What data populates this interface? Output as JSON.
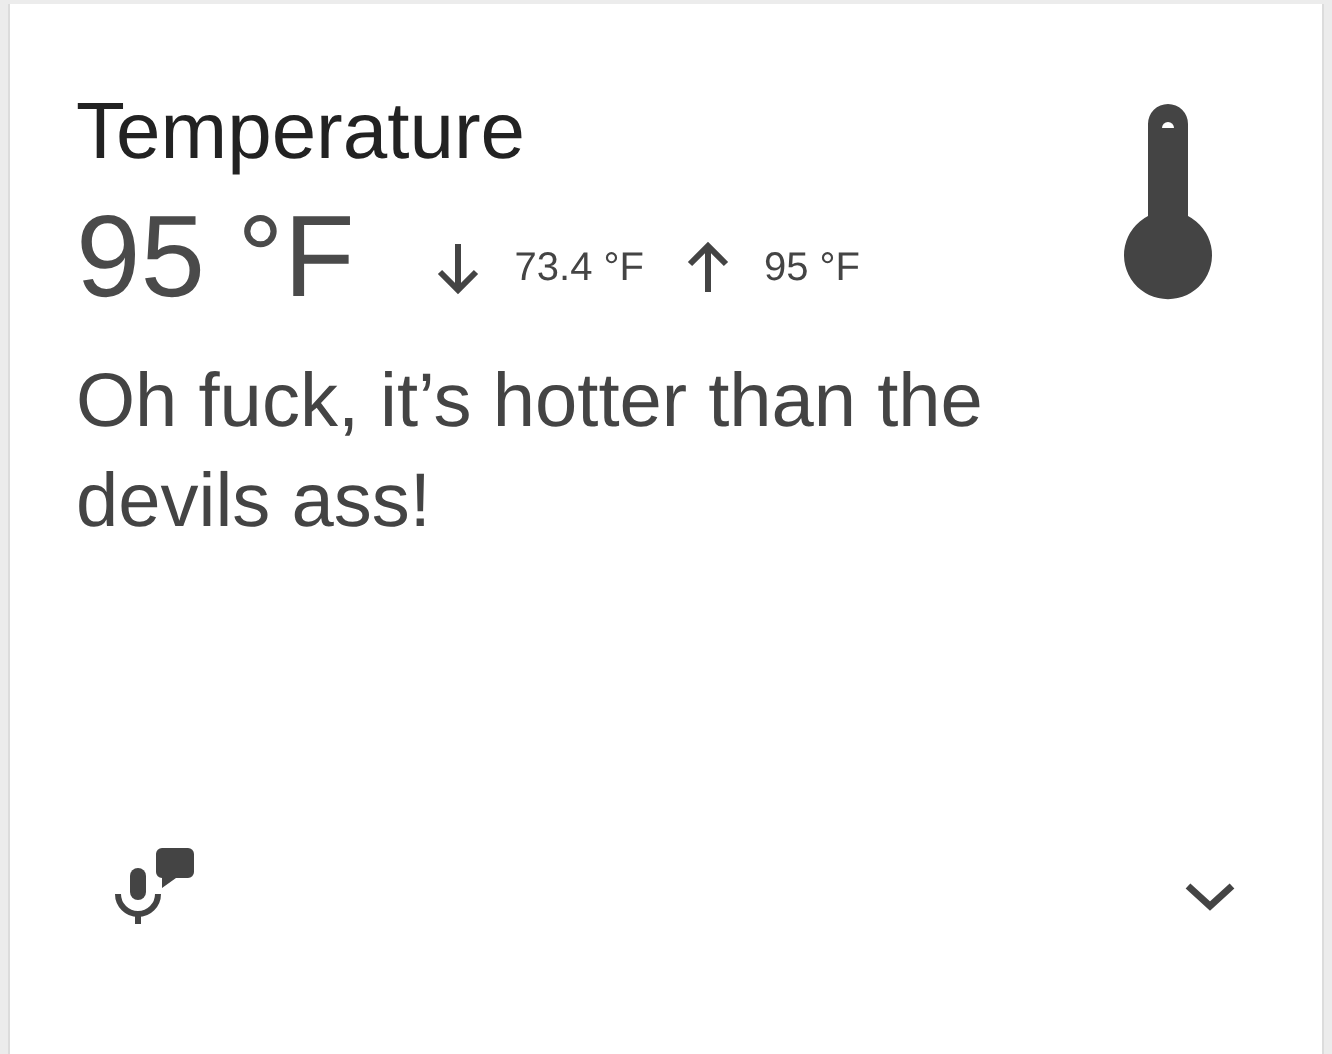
{
  "card": {
    "title": "Temperature",
    "current": "95 °F",
    "low": "73.4 °F",
    "high": "95 °F",
    "message": "Oh fuck, it’s hotter than the devils ass!",
    "expanded": false
  }
}
